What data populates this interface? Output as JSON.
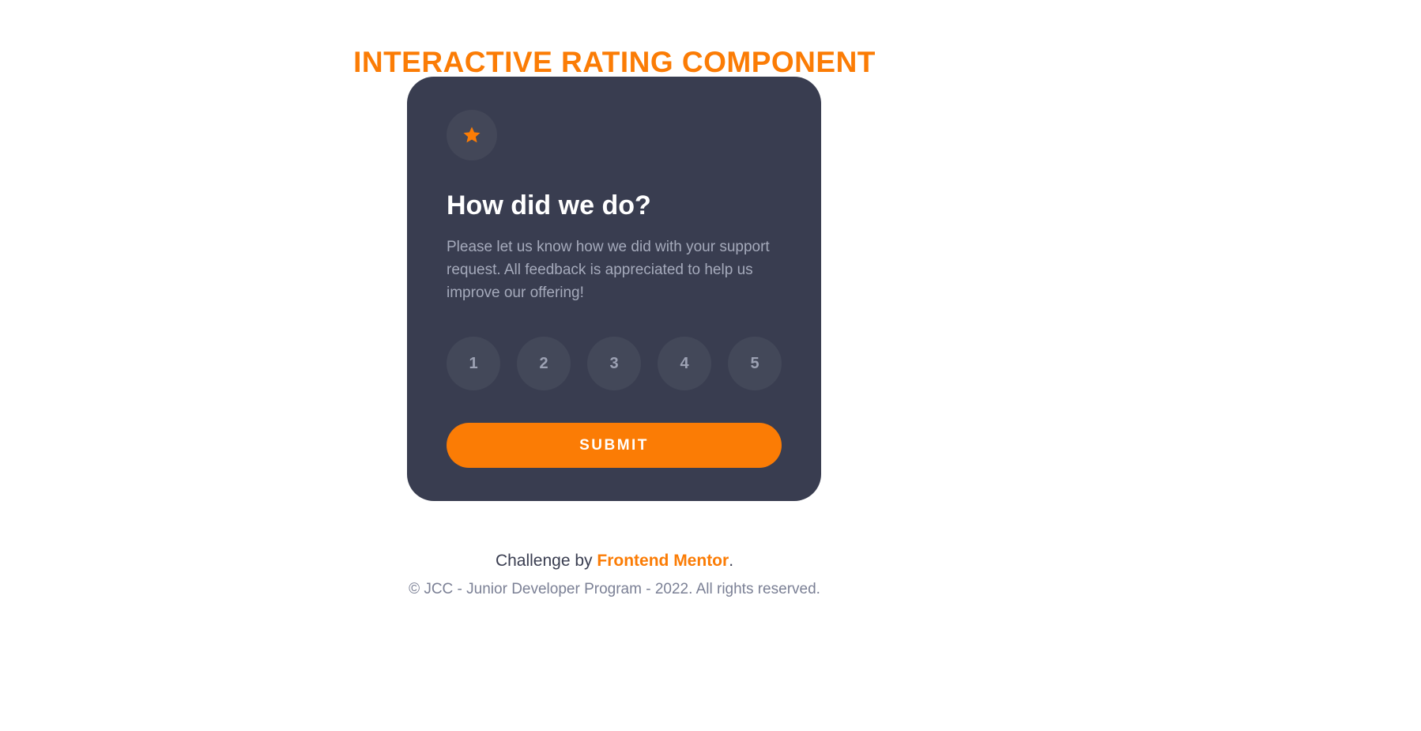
{
  "page": {
    "title": "INTERACTIVE RATING COMPONENT"
  },
  "card": {
    "icon": "star-icon",
    "heading": "How did we do?",
    "description": "Please let us know how we did with your support request. All feedback is appreciated to help us improve our offering!",
    "ratings": [
      "1",
      "2",
      "3",
      "4",
      "5"
    ],
    "submit_label": "SUBMIT"
  },
  "footer": {
    "challenge_prefix": "Challenge by ",
    "challenge_link": "Frontend Mentor",
    "challenge_suffix": ".",
    "copyright": "© JCC - Junior Developer Program - 2022. All rights reserved."
  },
  "colors": {
    "accent": "#fb7c05",
    "card_bg": "#393d50",
    "badge_bg": "#434858",
    "muted_text": "#a5aabb"
  }
}
